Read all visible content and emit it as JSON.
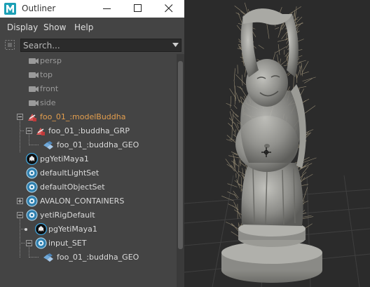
{
  "window": {
    "title": "Outliner",
    "app_icon": "maya-logo-icon",
    "controls": [
      "minimize-icon",
      "maximize-icon",
      "close-icon"
    ]
  },
  "menubar": {
    "display": "Display",
    "show": "Show",
    "help": "Help"
  },
  "search": {
    "placeholder": "Search...",
    "filter_icon": "filter-icon",
    "dropdown_icon": "chevron-down-icon"
  },
  "tree": [
    {
      "label": "persp",
      "icon": "camera-icon",
      "depth": 1,
      "style": "camera"
    },
    {
      "label": "top",
      "icon": "camera-icon",
      "depth": 1,
      "style": "camera"
    },
    {
      "label": "front",
      "icon": "camera-icon",
      "depth": 1,
      "style": "camera"
    },
    {
      "label": "side",
      "icon": "camera-icon",
      "depth": 1,
      "style": "camera"
    },
    {
      "label": "foo_01_:modelBuddha",
      "icon": "reference-transform-icon",
      "depth": 1,
      "expanded": true,
      "style": "reference"
    },
    {
      "label": "foo_01_:buddha_GRP",
      "icon": "reference-transform-icon",
      "depth": 2,
      "expanded": true,
      "style": "normal"
    },
    {
      "label": "foo_01_:buddha_GEO",
      "icon": "mesh-icon",
      "depth": 3,
      "style": "normal"
    },
    {
      "label": "pgYetiMaya1",
      "icon": "yeti-node-icon",
      "depth": 1,
      "style": "normal"
    },
    {
      "label": "defaultLightSet",
      "icon": "object-set-icon",
      "depth": 1,
      "style": "normal"
    },
    {
      "label": "defaultObjectSet",
      "icon": "object-set-icon",
      "depth": 1,
      "style": "normal"
    },
    {
      "label": "AVALON_CONTAINERS",
      "icon": "object-set-icon",
      "depth": 1,
      "expanded": false,
      "style": "normal"
    },
    {
      "label": "yetiRigDefault",
      "icon": "object-set-icon",
      "depth": 1,
      "expanded": true,
      "style": "normal"
    },
    {
      "label": "pgYetiMaya1",
      "icon": "yeti-node-icon",
      "depth": 2,
      "style": "normal"
    },
    {
      "label": "input_SET",
      "icon": "object-set-icon",
      "depth": 2,
      "expanded": true,
      "style": "normal"
    },
    {
      "label": "foo_01_:buddha_GEO",
      "icon": "mesh-icon",
      "depth": 3,
      "style": "normal"
    }
  ],
  "viewport": {
    "subject": "buddha-statue-with-yeti-fur",
    "cursor_icon": "crosshair-cursor-icon"
  },
  "colors": {
    "reference": "#e39e4e",
    "camera": "#9a9a9a",
    "text": "#dadada",
    "panel": "#444444",
    "viewport_bg": "#2b2b2b"
  }
}
